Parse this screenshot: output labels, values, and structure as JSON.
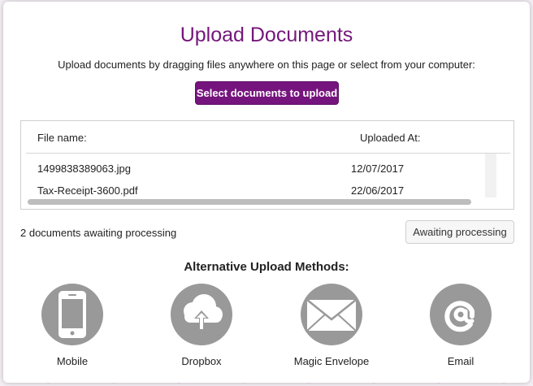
{
  "modal": {
    "title": "Upload Documents",
    "subtitle": "Upload documents by dragging files anywhere on this page or select from your computer:",
    "select_button_label": "Select documents to upload"
  },
  "table": {
    "columns": [
      "File name:",
      "Uploaded At:"
    ],
    "rows": [
      {
        "name": "1499838389063.jpg",
        "uploaded_at": "12/07/2017"
      },
      {
        "name": "Tax-Receipt-3600.pdf",
        "uploaded_at": "22/06/2017"
      }
    ]
  },
  "status": {
    "text": "2 documents awaiting processing",
    "button_label": "Awaiting processing"
  },
  "alternatives": {
    "title": "Alternative Upload Methods:",
    "methods": [
      {
        "label": "Mobile",
        "icon": "mobile-phone-icon"
      },
      {
        "label": "Dropbox",
        "icon": "cloud-upload-icon"
      },
      {
        "label": "Magic Envelope",
        "icon": "envelope-icon"
      },
      {
        "label": "Email",
        "icon": "at-sign-icon"
      }
    ]
  },
  "colors": {
    "accent": "#76147e",
    "title": "#74177a",
    "icon_circle": "#999999"
  }
}
